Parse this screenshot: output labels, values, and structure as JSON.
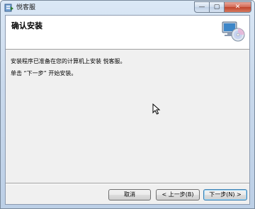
{
  "window": {
    "title": "悦客服",
    "controls": {
      "minimize": "—",
      "maximize": "▢",
      "close": "✕"
    }
  },
  "banner": {
    "heading": "确认安装"
  },
  "content": {
    "line1": "安装程序已准备在您的计算机上安装 悦客服。",
    "line2": "单击 “下一步” 开始安装。"
  },
  "buttons": {
    "cancel": "取消",
    "back": "< 上一步(B)",
    "next": "下一步(N) >"
  },
  "icons": {
    "app": "installer-app-icon",
    "banner": "computer-cd-icon",
    "cursor": "mouse-cursor-icon"
  }
}
